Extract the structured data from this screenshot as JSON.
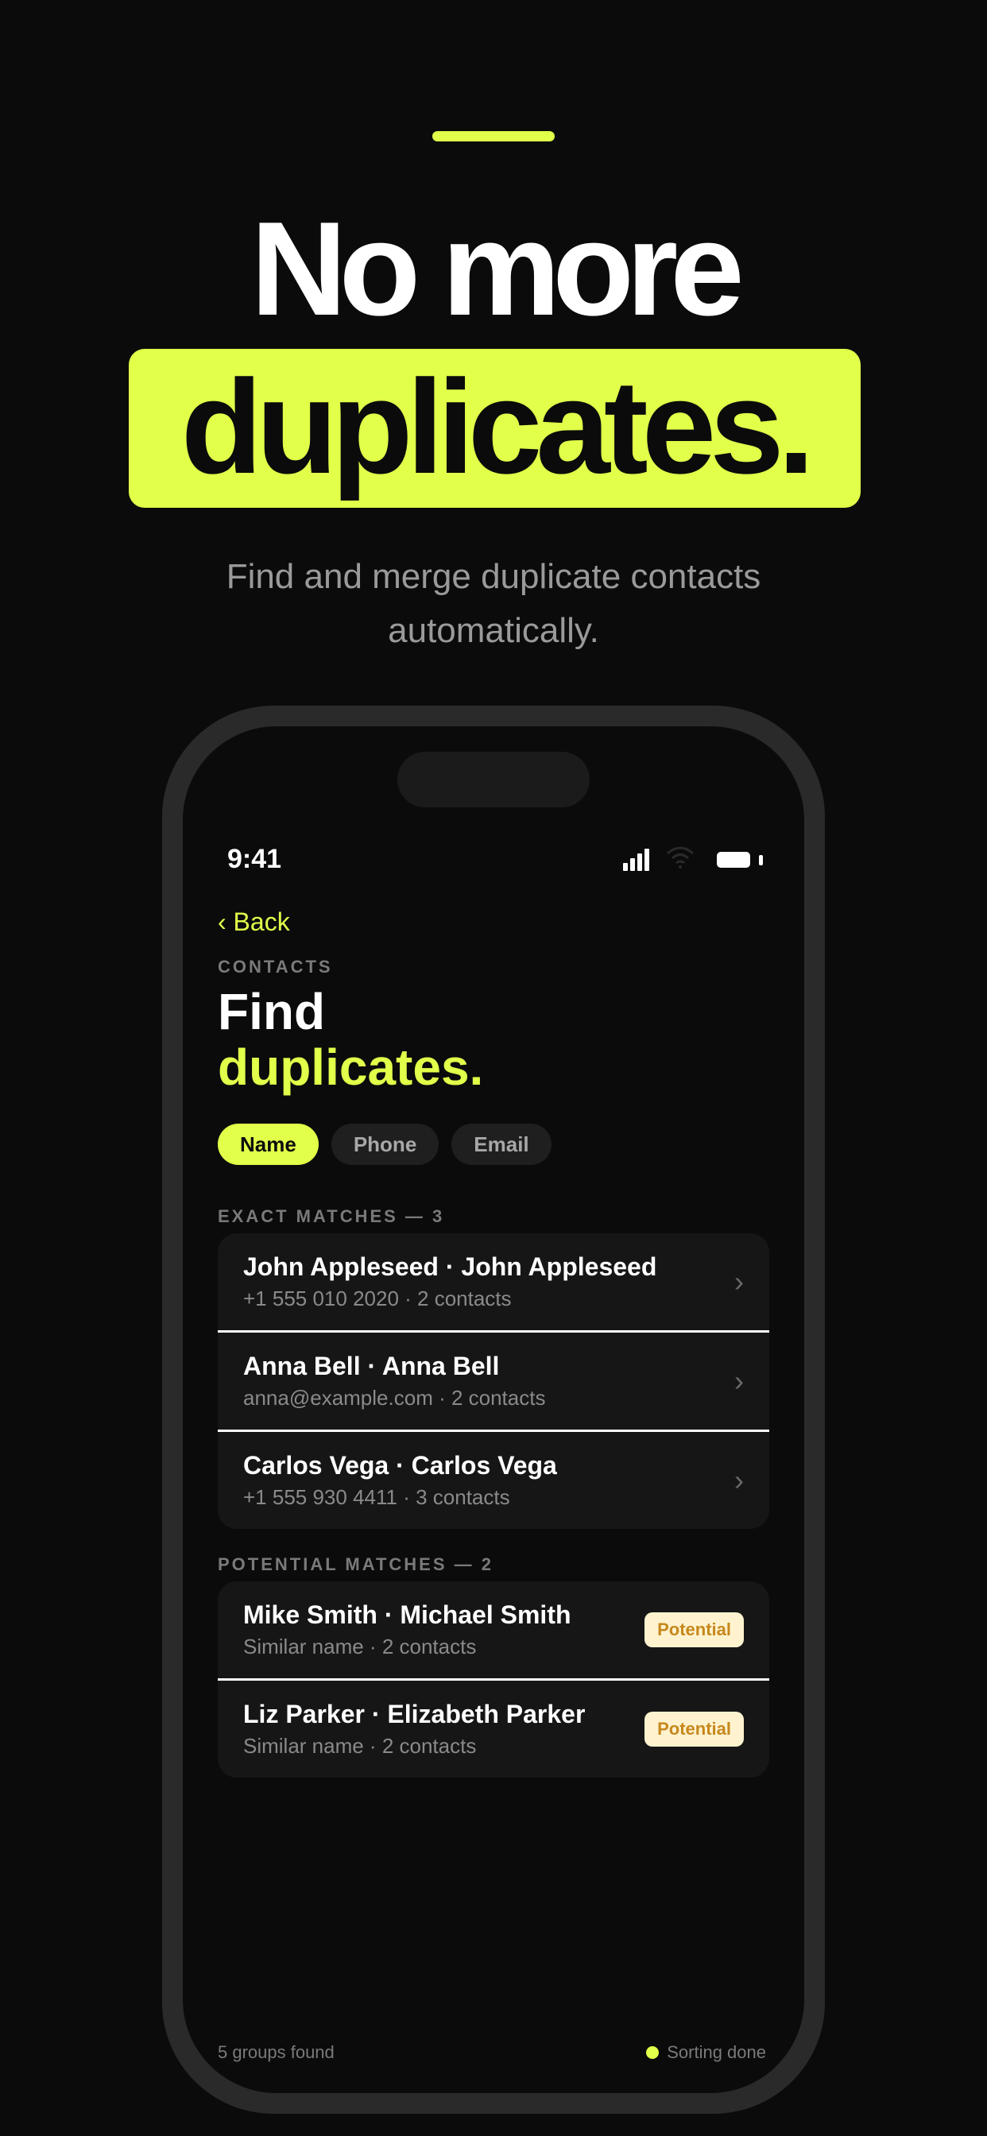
{
  "marketing": {
    "headline_line1": "No more",
    "headline_line2": "duplicates.",
    "subtitle": "Find and merge duplicate contacts automatically.",
    "accent_color": "#e2ff4a"
  },
  "status_bar": {
    "time": "9:41",
    "icons": [
      "cellular-signal-icon",
      "wifi-icon",
      "battery-icon"
    ]
  },
  "nav": {
    "back_label": "‹ Back"
  },
  "header": {
    "kicker": "CONTACTS",
    "title_line1": "Find",
    "title_line2": "duplicates."
  },
  "tabs": [
    {
      "label": "Name",
      "active": true
    },
    {
      "label": "Phone",
      "active": false
    },
    {
      "label": "Email",
      "active": false
    }
  ],
  "exact_matches": {
    "label": "EXACT MATCHES — 3",
    "items": [
      {
        "title": "John Appleseed · John Appleseed",
        "subtitle": "+1 555 010 2020 · 2 contacts",
        "chevron": "›"
      },
      {
        "title": "Anna Bell · Anna Bell",
        "subtitle": "anna@example.com · 2 contacts",
        "chevron": "›"
      },
      {
        "title": "Carlos Vega · Carlos Vega",
        "subtitle": "+1 555 930 4411 · 3 contacts",
        "chevron": "›"
      }
    ]
  },
  "potential_matches": {
    "label": "POTENTIAL MATCHES — 2",
    "items": [
      {
        "title": "Mike Smith · Michael Smith",
        "subtitle": "Similar name · 2 contacts",
        "badge": "Potential"
      },
      {
        "title": "Liz Parker · Elizabeth Parker",
        "subtitle": "Similar name · 2 contacts",
        "badge": "Potential"
      }
    ]
  },
  "footer": {
    "groups_found": "5 groups found",
    "status": "Sorting done"
  }
}
